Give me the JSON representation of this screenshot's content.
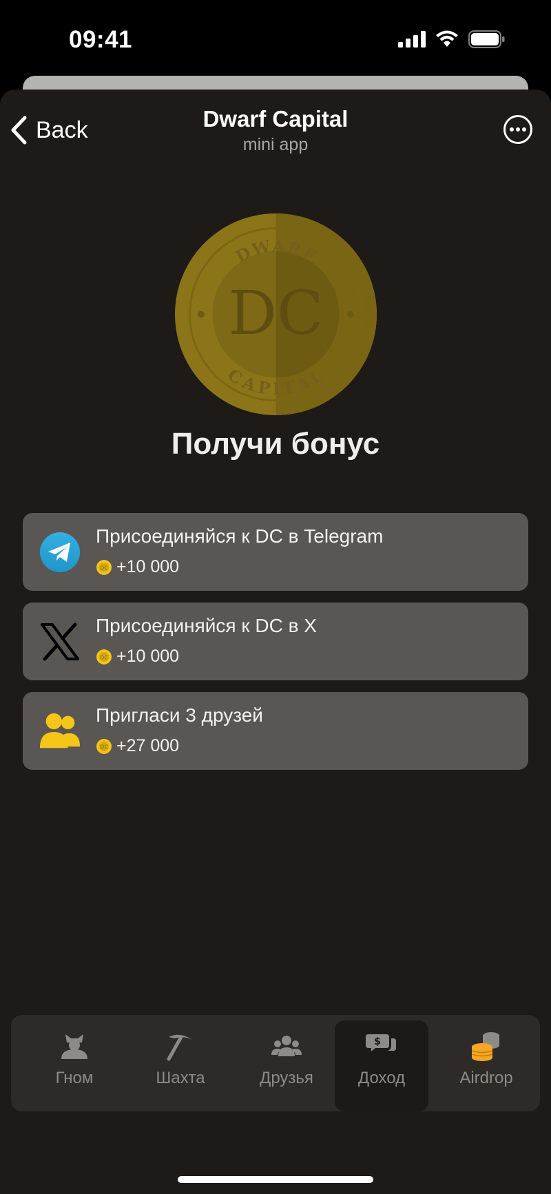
{
  "status_bar": {
    "time": "09:41"
  },
  "header": {
    "back_label": "Back",
    "title": "Dwarf Capital",
    "subtitle": "mini app"
  },
  "coin": {
    "top_text": "DWARF",
    "center_text": "DC",
    "bottom_text": "CAPITAL"
  },
  "heading": "Получи бонус",
  "tasks": [
    {
      "title": "Присоединяйся к DC в Telegram",
      "reward": "+10 000",
      "icon": "telegram-icon"
    },
    {
      "title": "Присоединяйся к DC в X",
      "reward": "+10 000",
      "icon": "x-icon"
    },
    {
      "title": "Пригласи 3 друзей",
      "reward": "+27 000",
      "icon": "friends-icon"
    }
  ],
  "tabbar": {
    "active": "Доход",
    "tabs": [
      {
        "label": "Гном",
        "icon": "gnome-icon"
      },
      {
        "label": "Шахта",
        "icon": "pickaxe-icon"
      },
      {
        "label": "Друзья",
        "icon": "friends-icon"
      },
      {
        "label": "Доход",
        "icon": "income-icon"
      },
      {
        "label": "Airdrop",
        "icon": "coins-icon"
      }
    ]
  },
  "colors": {
    "background": "#1e1a18",
    "card": "#5a5653",
    "coin_gold": "#8a7418",
    "accent_yellow": "#f5c518"
  }
}
